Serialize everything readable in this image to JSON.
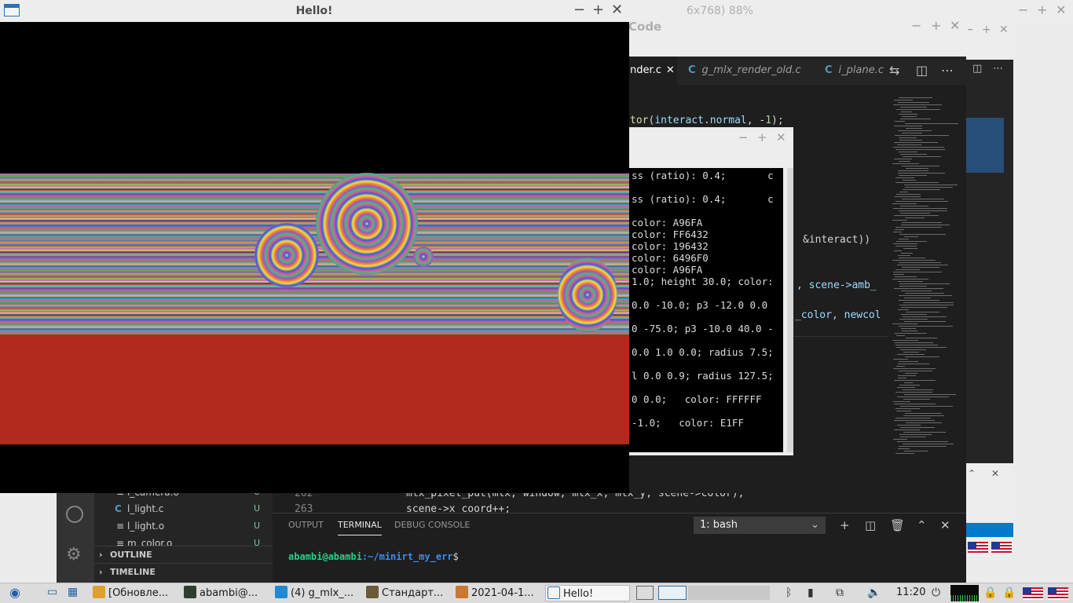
{
  "image_viewer": {
    "title_partial": "6x768) 88%"
  },
  "vscode": {
    "title_partial": "Code",
    "tabs": [
      {
        "label": "nder.c",
        "icon": "C",
        "active": true
      },
      {
        "label": "g_mlx_render_old.c",
        "icon": "C",
        "active": false
      },
      {
        "label": "i_plane.c",
        "icon": "C",
        "active": false
      }
    ],
    "code_lines": [
      {
        "text": "tor(interact.normal, -1);"
      },
      {
        "text": "&interact))"
      },
      {
        "text": ", scene->amb_"
      },
      {
        "text": "_color, newcol"
      },
      {
        "lineno": "262",
        "text": "mlx_pixel_put(mlx, window, mlx_x, mlx_y, scene->color);"
      },
      {
        "lineno": "263",
        "text": "scene->x_coord++;"
      }
    ],
    "sidebar": {
      "files": [
        {
          "name": "l_camera.o",
          "icon": "≡",
          "status": "U"
        },
        {
          "name": "l_light.c",
          "icon": "C",
          "status": "U"
        },
        {
          "name": "l_light.o",
          "icon": "≡",
          "status": "U"
        },
        {
          "name": "m_color.o",
          "icon": "≡",
          "status": "U"
        }
      ],
      "sections": [
        "OUTLINE",
        "TIMELINE"
      ]
    },
    "panel": {
      "tabs": [
        "OUTPUT",
        "TERMINAL",
        "DEBUG CONSOLE"
      ],
      "active_tab": "TERMINAL",
      "shell_select": "1: bash",
      "prompt_user": "abambi@abambi",
      "prompt_path": ":~/minirt_my_err",
      "prompt_symbol": "$"
    }
  },
  "terminal": {
    "lines": [
      "ss (ratio): 0.4;       c",
      "ss (ratio): 0.4;       c",
      "color: A96FA",
      "color: FF6432",
      "color: 196432",
      "color: 6496F0",
      "color: A96FA",
      "1.0; height 30.0; color:",
      "0.0 -10.0; p3 -12.0 0.0",
      "0 -75.0; p3 -10.0 40.0 -",
      "0.0 1.0 0.0; radius 7.5;",
      "l 0.0 0.9; radius 127.5;",
      "0 0.0;   color: FFFFFF",
      "-1.0;   color: E1FF"
    ]
  },
  "hello_window": {
    "title": "Hello!"
  },
  "taskbar": {
    "tasks": [
      {
        "label": "[Обновле...",
        "icon": "package-icon"
      },
      {
        "label": "abambi@...",
        "icon": "terminal-icon"
      },
      {
        "label": "(4) g_mlx_...",
        "icon": "vscode-icon"
      },
      {
        "label": "Стандарт...",
        "icon": "folder-icon"
      },
      {
        "label": "2021-04-1...",
        "icon": "image-icon"
      },
      {
        "label": "Hello!",
        "icon": "window-icon"
      }
    ],
    "clock": "11:20"
  }
}
